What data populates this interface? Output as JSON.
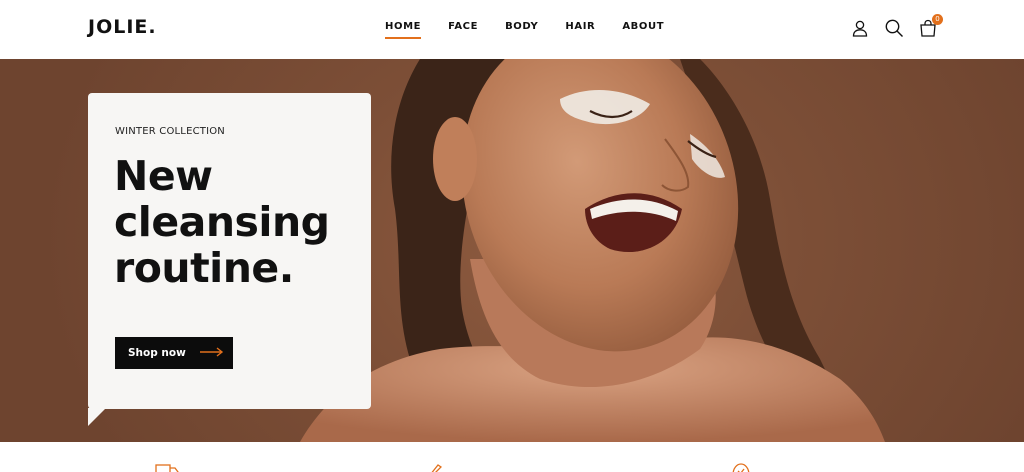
{
  "brand": {
    "logo": "JOLIE."
  },
  "nav": [
    {
      "label": "HOME",
      "active": true
    },
    {
      "label": "FACE",
      "active": false
    },
    {
      "label": "BODY",
      "active": false
    },
    {
      "label": "HAIR",
      "active": false
    },
    {
      "label": "ABOUT",
      "active": false
    }
  ],
  "header_icons": {
    "account": "user-icon",
    "search": "search-icon",
    "cart": "shopping-bag-icon",
    "cart_count": "0"
  },
  "hero": {
    "eyebrow": "WINTER COLLECTION",
    "headline_lines": [
      "New",
      "cleansing",
      "routine."
    ],
    "cta_label": "Shop now",
    "cta_icon": "arrow-right-icon",
    "image": "smiling-woman-with-face-cream-photo"
  },
  "features": {
    "icons": [
      "truck-icon",
      "pen-icon",
      "check-circle-icon"
    ]
  },
  "colors": {
    "accent": "#e2701c",
    "hero_bg": "#7d4f37",
    "button_bg": "#0c0c0c",
    "card_bg": "#f7f6f4"
  }
}
